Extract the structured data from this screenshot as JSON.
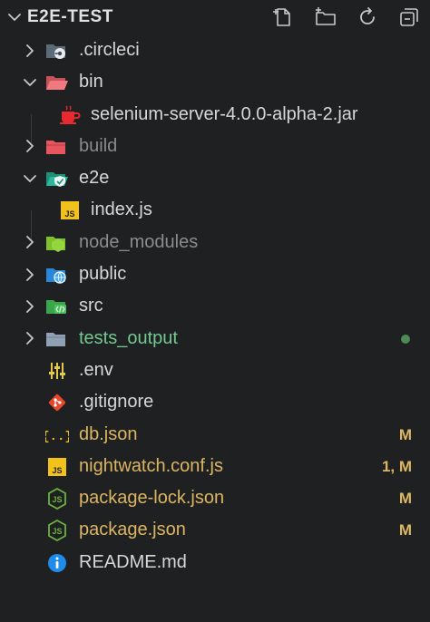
{
  "explorer": {
    "title": "E2E-TEST",
    "actions": [
      {
        "name": "new-file-icon"
      },
      {
        "name": "new-folder-icon"
      },
      {
        "name": "refresh-icon"
      },
      {
        "name": "collapse-all-icon"
      }
    ]
  },
  "tree": [
    {
      "label": ".circleci",
      "type": "folder",
      "expanded": false,
      "icon": "circleci-folder-icon",
      "level": 0
    },
    {
      "label": "bin",
      "type": "folder",
      "expanded": true,
      "icon": "bin-folder-icon",
      "level": 0
    },
    {
      "label": "selenium-server-4.0.0-alpha-2.jar",
      "type": "file",
      "icon": "java-jar-icon",
      "level": 1
    },
    {
      "label": "build",
      "type": "folder",
      "expanded": false,
      "icon": "build-folder-icon",
      "level": 0,
      "dimmed": true
    },
    {
      "label": "e2e",
      "type": "folder",
      "expanded": true,
      "icon": "e2e-folder-icon",
      "level": 0
    },
    {
      "label": "index.js",
      "type": "file",
      "icon": "js-file-icon",
      "level": 1
    },
    {
      "label": "node_modules",
      "type": "folder",
      "expanded": false,
      "icon": "node-modules-folder-icon",
      "level": 0,
      "dimmed": true
    },
    {
      "label": "public",
      "type": "folder",
      "expanded": false,
      "icon": "public-folder-icon",
      "level": 0
    },
    {
      "label": "src",
      "type": "folder",
      "expanded": false,
      "icon": "src-folder-icon",
      "level": 0
    },
    {
      "label": "tests_output",
      "type": "folder",
      "expanded": false,
      "icon": "folder-icon",
      "level": 0,
      "status": "untracked"
    },
    {
      "label": ".env",
      "type": "file",
      "icon": "env-file-icon",
      "level": 0
    },
    {
      "label": ".gitignore",
      "type": "file",
      "icon": "git-file-icon",
      "level": 0
    },
    {
      "label": "db.json",
      "type": "file",
      "icon": "json-file-icon",
      "level": 0,
      "badge": "M"
    },
    {
      "label": "nightwatch.conf.js",
      "type": "file",
      "icon": "js-file-icon",
      "level": 0,
      "badge": "1, M"
    },
    {
      "label": "package-lock.json",
      "type": "file",
      "icon": "nodejs-file-icon",
      "level": 0,
      "badge": "M"
    },
    {
      "label": "package.json",
      "type": "file",
      "icon": "nodejs-file-icon",
      "level": 0,
      "badge": "M"
    },
    {
      "label": "README.md",
      "type": "file",
      "icon": "info-file-icon",
      "level": 0
    }
  ],
  "colors": {
    "background": "#1f2022",
    "text": "#d7d7d7",
    "dimmed": "#8b8b8b",
    "untracked": "#74c991",
    "modified": "#dcb662"
  }
}
